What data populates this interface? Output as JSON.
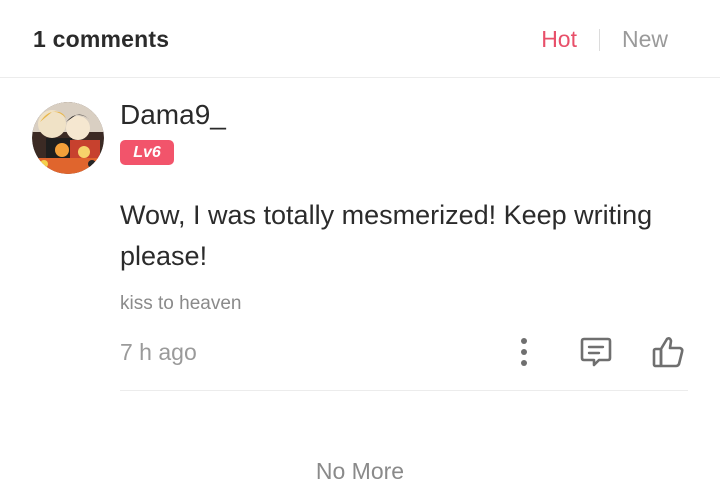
{
  "header": {
    "comment_count_label": "1 comments",
    "tabs": [
      {
        "label": "Hot",
        "active": true
      },
      {
        "label": "New",
        "active": false
      }
    ],
    "accent_color": "#e8506a"
  },
  "comment": {
    "username": "Dama9_",
    "level": "Lv6",
    "level_color": "#f2546b",
    "text": "Wow, I was totally mesmerized! Keep writing please!",
    "tag": "kiss to heaven",
    "time": "7 h ago",
    "actions": [
      "more-vertical-icon",
      "comment-icon",
      "thumbs-up-icon"
    ]
  },
  "footer": {
    "end_label": "No More"
  }
}
